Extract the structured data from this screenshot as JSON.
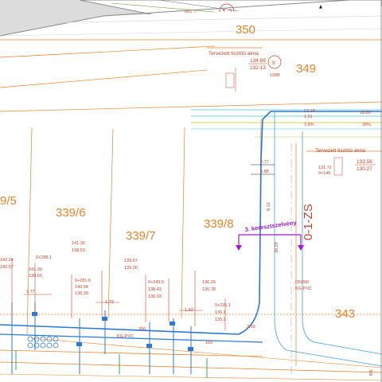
{
  "sheet": {
    "top_ref": "059.7",
    "top_ref_circle": "1.2"
  },
  "parcels": {
    "p350": "350",
    "p349": "349",
    "p339_5": "9/5",
    "p339_6": "339/6",
    "p339_7": "339/7",
    "p339_8": "339/8",
    "p343": "343"
  },
  "manholes": {
    "upper": {
      "label": "Tervezett tisztító akna",
      "elev_top": "134.88",
      "elev_bottom": "132.13",
      "number": "9",
      "chainage": "100B"
    },
    "right": {
      "label": "Tervezett tisztító akna",
      "elev_top": "133.56",
      "elev_bottom": "130.27"
    }
  },
  "cross_section": {
    "label": "3. keresztszelvény"
  },
  "road": {
    "name": "0-1-ZS"
  },
  "pipes": {
    "main_diameter": "DN200",
    "main_material": "KG-PVC",
    "label_kg": "KG-PVC",
    "slope_1": "8.12",
    "slope_2": "38.29"
  },
  "measures": {
    "m1": "2.77",
    "m2": "6.88",
    "m3": "12.18",
    "m4": "1.51",
    "m5": "18.89",
    "m6": "3.8%",
    "m7": "30%",
    "m8": "131.71",
    "m9": "0+146"
  },
  "connections": [
    {
      "station": "0+288.1",
      "e1": "142.24",
      "e2": "140.57"
    },
    {
      "station": "",
      "e1": "141.30",
      "e2": "138.53"
    },
    {
      "station": "0+281.6",
      "e1": "140.94",
      "e2": "138.39"
    },
    {
      "station": "",
      "e1": "139.67",
      "e2": "139.30"
    },
    {
      "station": "0+249.5",
      "e1": "138.43",
      "e2": "136.33"
    },
    {
      "station": "",
      "e1": "136.29",
      "e2": "136.78"
    },
    {
      "station": "0+231.1",
      "e1": "136.1",
      "e2": "135.2"
    }
  ],
  "misc": {
    "l350": "350",
    "l160": "160",
    "l1_77": "1.77",
    "l1_73": "1.73",
    "l1_60": "1.60",
    "l3_59": "3.59",
    "lbot": "BB"
  }
}
